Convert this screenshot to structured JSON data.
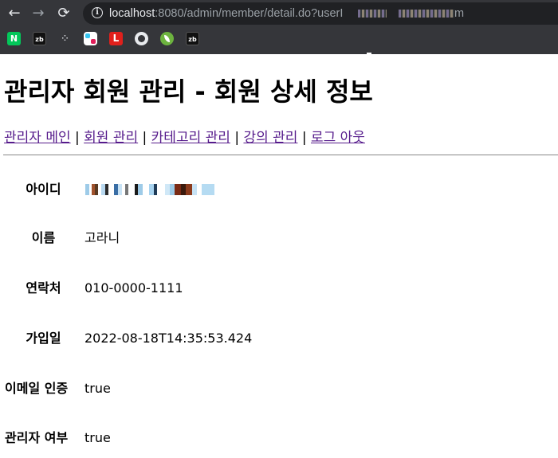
{
  "browser": {
    "back_label": "←",
    "forward_label": "→",
    "reload_label": "⟳",
    "info_label": "i",
    "url_host": "localhost",
    "url_path": ":8080/admin/member/detail.do?userI",
    "url_tail": "m",
    "bookmarks": [
      {
        "icon": "naver-icon",
        "label": "N"
      },
      {
        "icon": "zb-icon",
        "label": "zb"
      },
      {
        "icon": "dots-icon",
        "label": "⁘"
      },
      {
        "icon": "slack-icon",
        "label": ""
      },
      {
        "icon": "l-icon",
        "label": "L"
      },
      {
        "icon": "github-icon",
        "label": ""
      },
      {
        "icon": "spring-icon",
        "label": ""
      },
      {
        "icon": "zb-icon",
        "label": "zb"
      }
    ]
  },
  "page": {
    "title": "관리자 회원 관리 - 회원 상세 정보",
    "nav": [
      {
        "label": "관리자 메인"
      },
      {
        "label": "회원 관리"
      },
      {
        "label": "카테고리 관리"
      },
      {
        "label": "강의 관리"
      },
      {
        "label": "로그 아웃"
      }
    ],
    "nav_separator": "|",
    "details": [
      {
        "label": "아이디",
        "value": ""
      },
      {
        "label": "이름",
        "value": "고라니"
      },
      {
        "label": "연락처",
        "value": "010-0000-1111"
      },
      {
        "label": "가입일",
        "value": "2022-08-18T14:35:53.424"
      },
      {
        "label": "이메일 인증",
        "value": "true"
      },
      {
        "label": "관리자 여부",
        "value": "true"
      }
    ]
  }
}
